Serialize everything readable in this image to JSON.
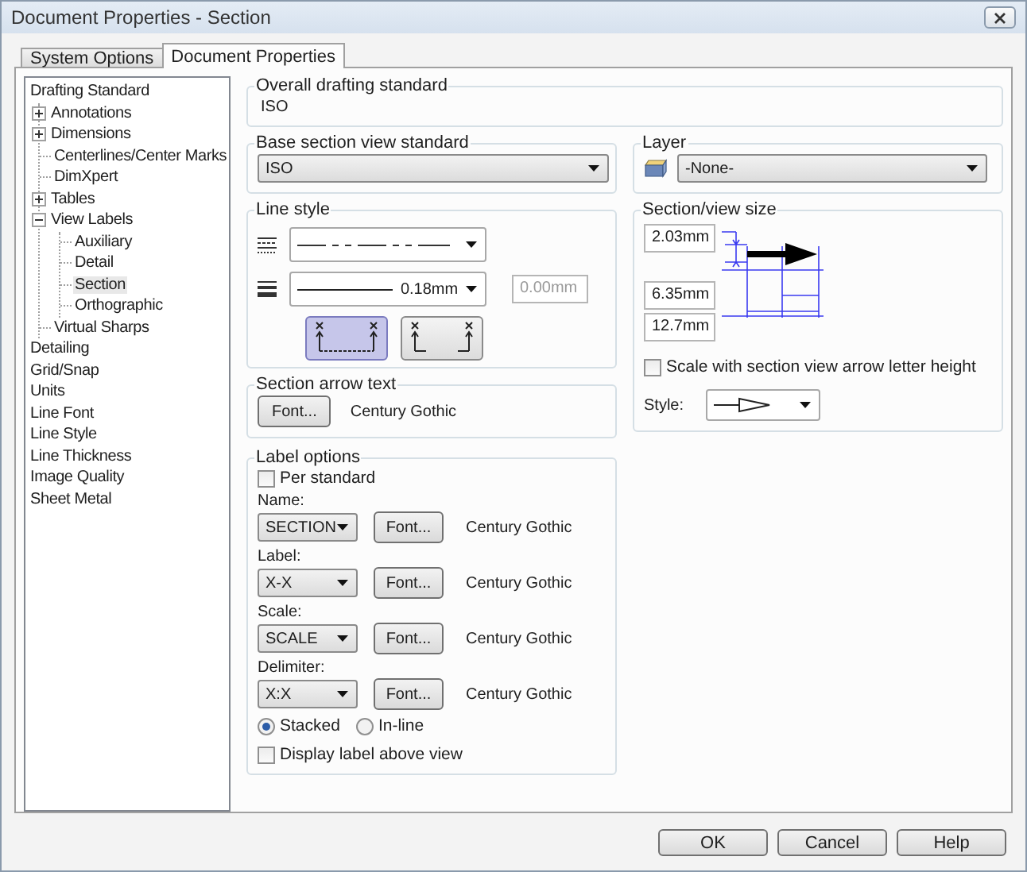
{
  "window": {
    "title": "Document Properties - Section"
  },
  "tabs": [
    {
      "label": "System Options",
      "selected": false
    },
    {
      "label": "Document Properties",
      "selected": true
    }
  ],
  "tree": [
    {
      "label": "Drafting Standard",
      "selected": false,
      "children": [
        {
          "label": "Annotations",
          "selected": false,
          "expanded": false
        },
        {
          "label": "Dimensions",
          "selected": false,
          "expanded": false
        },
        {
          "label": "Centerlines/Center Marks",
          "selected": false
        },
        {
          "label": "DimXpert",
          "selected": false
        },
        {
          "label": "Tables",
          "selected": false,
          "expanded": false
        },
        {
          "label": "View Labels",
          "selected": false,
          "expanded": true,
          "children": [
            {
              "label": "Auxiliary",
              "selected": false
            },
            {
              "label": "Detail",
              "selected": false
            },
            {
              "label": "Section",
              "selected": true
            },
            {
              "label": "Orthographic",
              "selected": false
            }
          ]
        },
        {
          "label": "Virtual Sharps",
          "selected": false
        }
      ]
    },
    {
      "label": "Detailing",
      "selected": false
    },
    {
      "label": "Grid/Snap",
      "selected": false
    },
    {
      "label": "Units",
      "selected": false
    },
    {
      "label": "Line Font",
      "selected": false
    },
    {
      "label": "Line Style",
      "selected": false
    },
    {
      "label": "Line Thickness",
      "selected": false
    },
    {
      "label": "Image Quality",
      "selected": false
    },
    {
      "label": "Sheet Metal",
      "selected": false
    }
  ],
  "overall": {
    "title": "Overall drafting standard",
    "value": "ISO"
  },
  "base_section": {
    "title": "Base section view standard",
    "value": "ISO"
  },
  "layer": {
    "title": "Layer",
    "value": "-None-"
  },
  "line_style": {
    "title": "Line style",
    "thickness": "0.18mm",
    "custom_thickness": "0.00mm",
    "custom_disabled": true,
    "arrow_styles": [
      {
        "selected": true
      },
      {
        "selected": false
      }
    ]
  },
  "section_arrow_text": {
    "title": "Section arrow text",
    "button": "Font...",
    "font": "Century Gothic"
  },
  "label_options": {
    "title": "Label options",
    "per_standard": {
      "label": "Per standard",
      "checked": false
    },
    "rows": [
      {
        "label": "Name:",
        "value": "SECTION",
        "button": "Font...",
        "font": "Century Gothic"
      },
      {
        "label": "Label:",
        "value": "X-X",
        "button": "Font...",
        "font": "Century Gothic"
      },
      {
        "label": "Scale:",
        "value": "SCALE",
        "button": "Font...",
        "font": "Century Gothic"
      },
      {
        "label": "Delimiter:",
        "value": "X:X",
        "button": "Font...",
        "font": "Century Gothic"
      }
    ],
    "layout": [
      {
        "label": "Stacked",
        "selected": true
      },
      {
        "label": "In-line",
        "selected": false
      }
    ],
    "display_above": {
      "label": "Display label above view",
      "checked": false
    }
  },
  "section_view_size": {
    "title": "Section/view size",
    "values": [
      "2.03mm",
      "6.35mm",
      "12.7mm"
    ],
    "scale_checkbox": {
      "label": "Scale with section view arrow letter height",
      "checked": false
    },
    "style_label": "Style:"
  },
  "buttons": [
    "OK",
    "Cancel",
    "Help"
  ]
}
